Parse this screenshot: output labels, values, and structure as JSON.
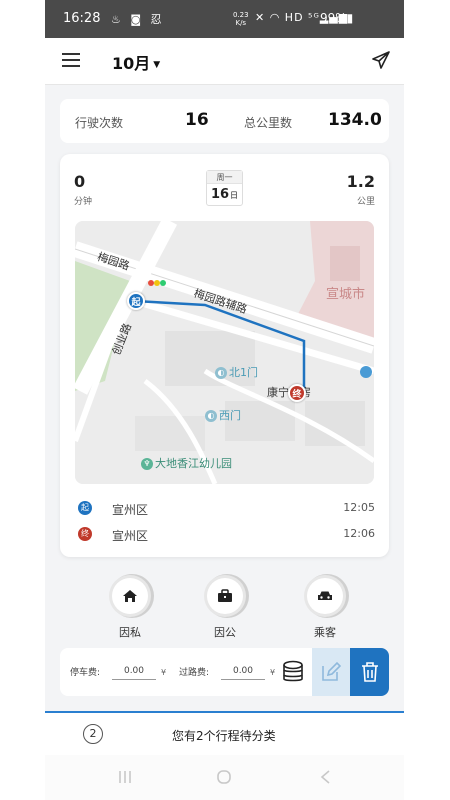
{
  "status_bar": {
    "time": "16:28",
    "left_icons": "♨ ◙ 忍",
    "speed_value": "0.23",
    "speed_unit": "K/s",
    "right_icons": "✕ ◠ HD ⁵ᴳ▂▄▆",
    "battery": "99%▮"
  },
  "header": {
    "month": "10月",
    "caret": "▼"
  },
  "stats": {
    "trips_label": "行驶次数",
    "trips_value": "16",
    "km_label": "总公里数",
    "km_value": "134.0"
  },
  "trip": {
    "duration_value": "0",
    "duration_unit": "分钟",
    "distance_value": "1.2",
    "distance_unit": "公里",
    "weekday": "周一",
    "day": "16",
    "day_suffix": "日",
    "start_marker": "起",
    "end_marker": "终",
    "start_area": "宣州区",
    "start_time": "12:05",
    "end_area": "宣州区",
    "end_time": "12:06",
    "route_color": "#1f73c0",
    "start_color": "#1f73c0",
    "end_color": "#c0392b"
  },
  "map": {
    "road_meiyuan": "梅园路",
    "road_meiyuan_aux": "梅园路辅路",
    "road_chuangye": "创业路",
    "district": "宣城市",
    "gate_north": "北1门",
    "gate_west": "西门",
    "pharmacy": "康宁药房",
    "kindergarten": "大地香江幼儿园",
    "gate_icon": "◐",
    "kindergarten_icon": "♆"
  },
  "categories": [
    {
      "label": "因私",
      "icon": "home-icon"
    },
    {
      "label": "因公",
      "icon": "briefcase-icon"
    },
    {
      "label": "乘客",
      "icon": "car-icon"
    }
  ],
  "fees": {
    "parking_label": "停车费:",
    "parking_value": "0.00",
    "toll_label": "过路费:",
    "toll_value": "0.00",
    "currency": "¥"
  },
  "pending": {
    "count": "2",
    "message": "您有2个行程待分类"
  }
}
